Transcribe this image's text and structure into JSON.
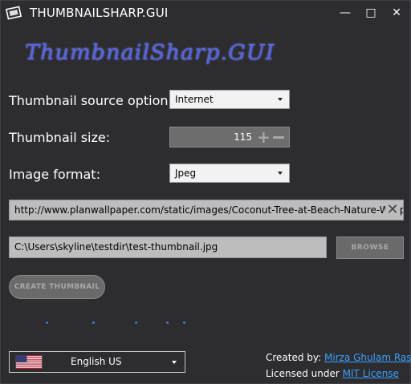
{
  "window": {
    "title": "THUMBNAILSHARP.GUI",
    "controls": {
      "minimize": "—",
      "maximize": "□",
      "close": "✕"
    }
  },
  "logo": {
    "text": "ThumbnailSharp.GUI"
  },
  "source": {
    "label": "Thumbnail source option:",
    "value": "Internet"
  },
  "size": {
    "label": "Thumbnail size:",
    "value": "115"
  },
  "format": {
    "label": "Image format:",
    "value": "Jpeg"
  },
  "url_field": {
    "value": "http://www.planwallpaper.com/static/images/Coconut-Tree-at-Beach-Nature-Wallpaper.jpg"
  },
  "output_field": {
    "value": "C:\\Users\\skyline\\testdir\\test-thumbnail.jpg"
  },
  "buttons": {
    "browse": "BROWSE",
    "create": "CREATE THUMBNAIL"
  },
  "language": {
    "value": "English US",
    "icon": "us-flag-icon"
  },
  "credits": {
    "created_by_label": "Created by:",
    "author": "Mirza Ghulam Rasyid",
    "licensed_label": "Licensed under",
    "license": "MIT License",
    "link_color": "#3aa0ff"
  },
  "colors": {
    "background": "#2d2d30",
    "progress_dot": "#4b6fd6"
  }
}
